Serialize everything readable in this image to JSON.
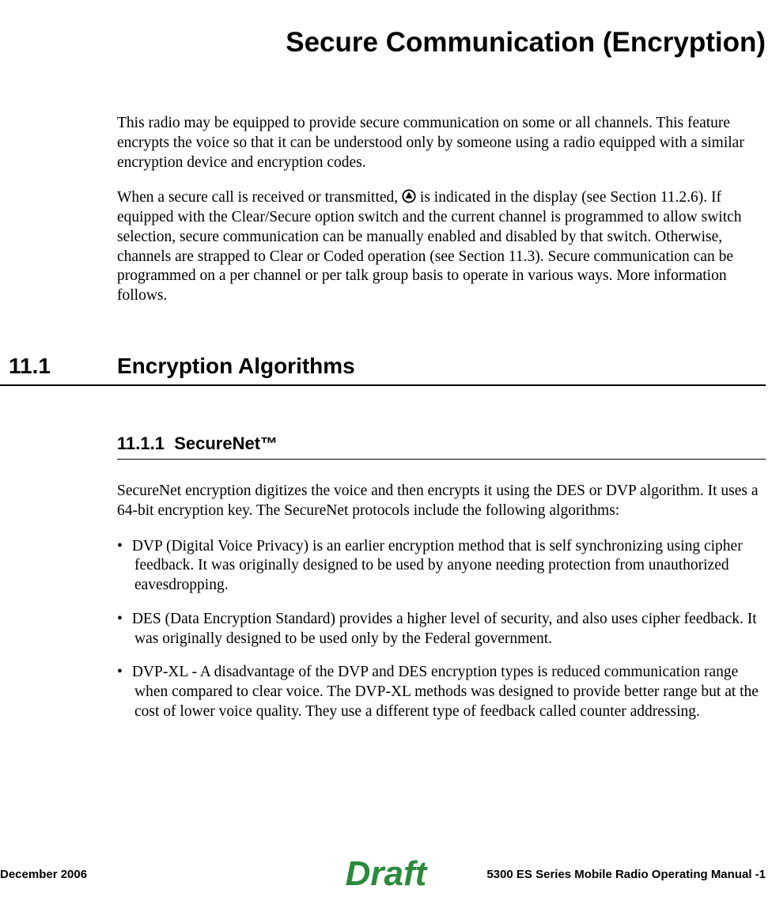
{
  "title": "Secure Communication (Encryption)",
  "intro_p1": "This radio may be equipped to provide secure communication on some or all channels. This feature encrypts the voice so that it can be understood only by someone using a radio equipped with a similar encryption device and encryption codes.",
  "intro_p2_pre": "When a secure call is received or transmitted, ",
  "intro_p2_post": " is indicated in the display (see Section 11.2.6). If equipped with the Clear/Secure option switch and the current channel is programmed to allow switch selection, secure communication can be manually enabled and disabled by that switch. Otherwise, channels are strapped to Clear or Coded operation (see Section 11.3). Secure communication can be programmed on a per channel or per talk group basis to operate in various ways. More information follows.",
  "section": {
    "num": "11.1",
    "title": "Encryption Algorithms",
    "sub_num": "11.1.1",
    "sub_title": "SecureNet™",
    "sub_intro": "SecureNet encryption digitizes the voice and then encrypts it using the DES or DVP algorithm. It uses a 64-bit encryption key. The SecureNet protocols include the following algorithms:",
    "bullets": [
      "DVP (Digital Voice Privacy) is an earlier encryption method that is self synchronizing using cipher feedback. It was originally designed to be used by anyone needing protection from unauthorized eavesdropping.",
      "DES (Data Encryption Standard) provides a higher level of security, and also uses cipher feedback. It was originally designed to be used only by the Federal government.",
      "DVP-XL - A disadvantage of the DVP and DES encryption types is reduced communication range when compared to clear voice. The DVP-XL methods was designed to provide better range but at the cost of lower voice quality. They use a different type of feedback called counter addressing."
    ]
  },
  "footer": {
    "left": "December 2006",
    "right": "5300 ES Series Mobile Radio Operating Manual    -1",
    "watermark": "Draft"
  }
}
